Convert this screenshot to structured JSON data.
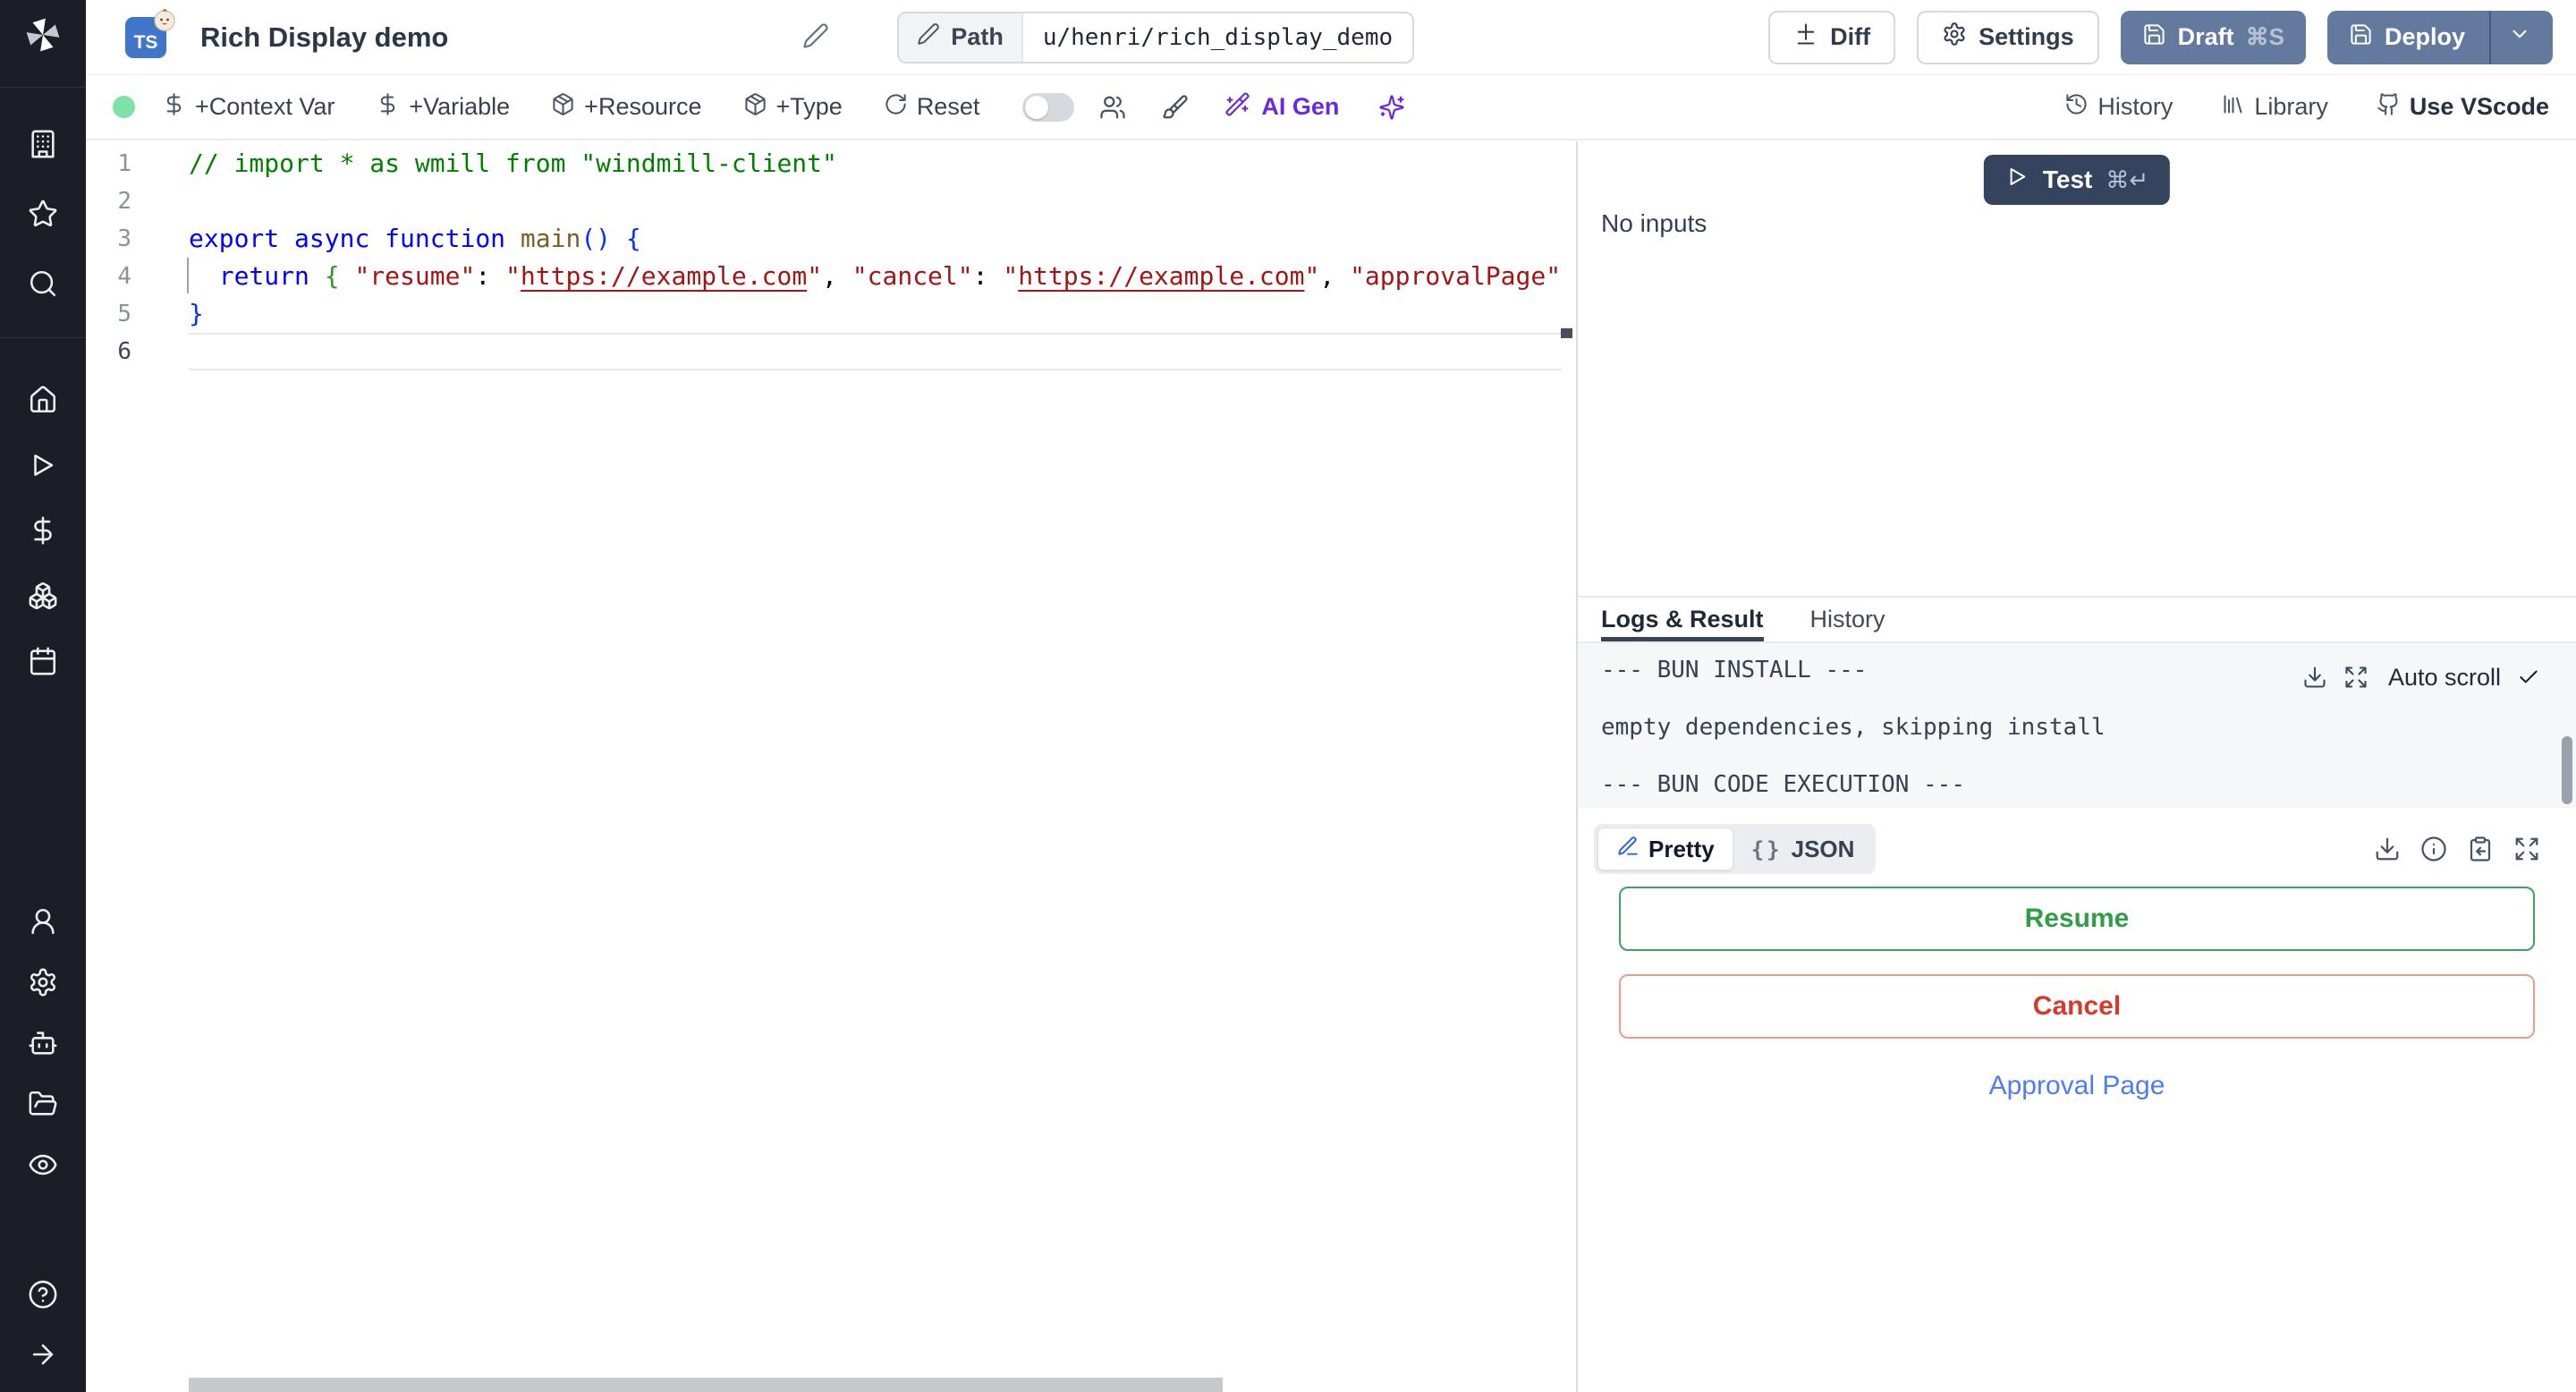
{
  "colors": {
    "sidebar_bg": "#1b1e26",
    "ts_blue": "#4076c9",
    "slate": "#64799e",
    "test_navy": "#34445f",
    "status_green": "#7ee2a8",
    "ai_purple": "#6d28d9",
    "green": "#2f9e44",
    "green_border": "#3ba55d",
    "red": "#d53a2a",
    "red_border": "#f09a8f",
    "link_blue": "#4d7cf6"
  },
  "sidebar": {
    "groups": {
      "top": [
        "building",
        "star",
        "search"
      ],
      "main": [
        "home",
        "play",
        "dollar",
        "boxes",
        "calendar"
      ],
      "admin": [
        "user",
        "settings",
        "bot",
        "folder-open",
        "eye"
      ],
      "bottom": [
        "help-circle",
        "arrow-right"
      ]
    }
  },
  "header": {
    "badge_text": "TS",
    "title": "Rich Display demo",
    "path_label": "Path",
    "path_value": "u/henri/rich_display_demo",
    "diff_label": "Diff",
    "settings_label": "Settings",
    "draft_label": "Draft",
    "draft_shortcut": "⌘S",
    "deploy_label": "Deploy"
  },
  "toolbar": {
    "items": [
      {
        "icon": "dollar",
        "label": "+Context Var"
      },
      {
        "icon": "dollar",
        "label": "+Variable"
      },
      {
        "icon": "package",
        "label": "+Resource"
      },
      {
        "icon": "package",
        "label": "+Type"
      },
      {
        "icon": "rotate",
        "label": "Reset"
      }
    ],
    "ai_label": "AI Gen",
    "right": [
      {
        "icon": "history",
        "label": "History"
      },
      {
        "icon": "library",
        "label": "Library"
      },
      {
        "icon": "github",
        "label": "Use VScode"
      }
    ]
  },
  "editor": {
    "line_numbers": [
      1,
      2,
      3,
      4,
      5,
      6
    ],
    "active_line": 6,
    "lines": [
      [
        {
          "t": "// import * as wmill from \"windmill-client\"",
          "s": "comment"
        }
      ],
      [],
      [
        {
          "t": "export",
          "s": "kw"
        },
        {
          "t": " ",
          "s": "plain"
        },
        {
          "t": "async",
          "s": "kw"
        },
        {
          "t": " ",
          "s": "plain"
        },
        {
          "t": "function",
          "s": "kw"
        },
        {
          "t": " ",
          "s": "plain"
        },
        {
          "t": "main",
          "s": "fn"
        },
        {
          "t": "()",
          "s": "br1"
        },
        {
          "t": " ",
          "s": "plain"
        },
        {
          "t": "{",
          "s": "br1"
        }
      ],
      [
        {
          "t": "  ",
          "s": "plain"
        },
        {
          "t": "return",
          "s": "kw"
        },
        {
          "t": " ",
          "s": "plain"
        },
        {
          "t": "{",
          "s": "br2"
        },
        {
          "t": " ",
          "s": "plain"
        },
        {
          "t": "\"resume\"",
          "s": "str"
        },
        {
          "t": ": ",
          "s": "plain"
        },
        {
          "t": "\"",
          "s": "str"
        },
        {
          "t": "https://example.com",
          "s": "link"
        },
        {
          "t": "\"",
          "s": "str"
        },
        {
          "t": ", ",
          "s": "plain"
        },
        {
          "t": "\"cancel\"",
          "s": "str"
        },
        {
          "t": ": ",
          "s": "plain"
        },
        {
          "t": "\"",
          "s": "str"
        },
        {
          "t": "https://example.com",
          "s": "link"
        },
        {
          "t": "\"",
          "s": "str"
        },
        {
          "t": ", ",
          "s": "plain"
        },
        {
          "t": "\"approvalPage\"",
          "s": "str"
        },
        {
          "t": ":",
          "s": "plain"
        }
      ],
      [
        {
          "t": "}",
          "s": "br1"
        }
      ],
      []
    ]
  },
  "run_panel": {
    "test_label": "Test",
    "test_shortcut": "⌘↵",
    "no_inputs": "No inputs",
    "tabs": [
      "Logs & Result",
      "History"
    ],
    "active_tab": "Logs & Result",
    "auto_scroll_label": "Auto scroll",
    "log_lines": [
      "--- BUN INSTALL ---",
      "",
      "empty dependencies, skipping install",
      "",
      "--- BUN CODE EXECUTION ---"
    ],
    "result": {
      "view_modes": [
        "Pretty",
        "JSON"
      ],
      "active_mode": "Pretty",
      "resume_label": "Resume",
      "cancel_label": "Cancel",
      "link_label": "Approval Page"
    }
  }
}
